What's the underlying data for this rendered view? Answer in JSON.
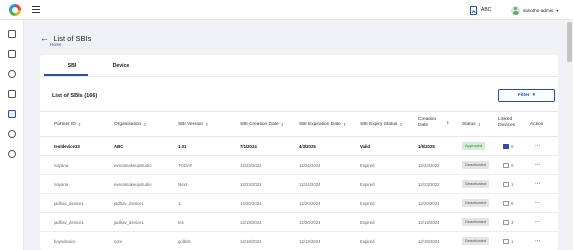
{
  "topbar": {
    "org": "ABC",
    "user": "sanotho-admin",
    "caret": "▾"
  },
  "page": {
    "back": "←",
    "title": "List of SBIs",
    "breadcrumb": "Home"
  },
  "tabs": [
    "SBI",
    "Device"
  ],
  "list": {
    "title": "List of SBIs (166)",
    "filter_label": "Filter",
    "filter_caret": "▾"
  },
  "columns": [
    "Partner ID",
    "Organisation",
    "SBI Version",
    "SBI Creation Date",
    "SBI Expiration Date",
    "SBI Expiry Status",
    "Creation Date",
    "Status",
    "Linked Devices",
    "Action"
  ],
  "rows": [
    {
      "partner": "testdevice33",
      "org": "ABC",
      "version": "1.01",
      "created": "7/1/2024",
      "expires": "4/3/2025",
      "expiry_status": "Valid",
      "creation_date": "1/5/2025",
      "status": "Approved",
      "devices": "0",
      "action": "..."
    },
    {
      "partner": "nayana",
      "org": "everamakeupstudio",
      "version": "TODAY",
      "created": "12/23/2022",
      "expires": "12/24/2024",
      "expiry_status": "Expired",
      "creation_date": "12/23/2022",
      "status": "Deactivated",
      "devices": "0",
      "action": "..."
    },
    {
      "partner": "nayana",
      "org": "everamakeupstudio",
      "version": "Next",
      "created": "12/23/2021",
      "expires": "12/24/2024",
      "expiry_status": "Expired",
      "creation_date": "12/23/2022",
      "status": "Deactivated",
      "devices": "1",
      "action": "..."
    },
    {
      "partner": "jadhav_device1",
      "org": "jadhav_device1",
      "version": "1",
      "created": "12/20/2024",
      "expires": "12/20/2024",
      "expiry_status": "Expired",
      "creation_date": "12/20/2024",
      "status": "Deactivated",
      "devices": "0",
      "action": "..."
    },
    {
      "partner": "jadhav_device1",
      "org": "jadhav_device1",
      "version": "tes",
      "created": "12/19/2024",
      "expires": "12/20/2024",
      "expiry_status": "Expired",
      "creation_date": "12/19/2024",
      "status": "Deactivated",
      "devices": "3",
      "action": "..."
    },
    {
      "partner": "boysdevice",
      "org": "core",
      "version": "golbds",
      "created": "12/18/2024",
      "expires": "12/19/2024",
      "expiry_status": "Expired",
      "creation_date": "12/18/2024",
      "status": "Deactivated",
      "devices": "1",
      "action": "..."
    }
  ],
  "colors": {
    "primary": "#2d4fa1",
    "approved_bg": "#d4ecd7",
    "deactivated_bg": "#e4e4e4"
  }
}
